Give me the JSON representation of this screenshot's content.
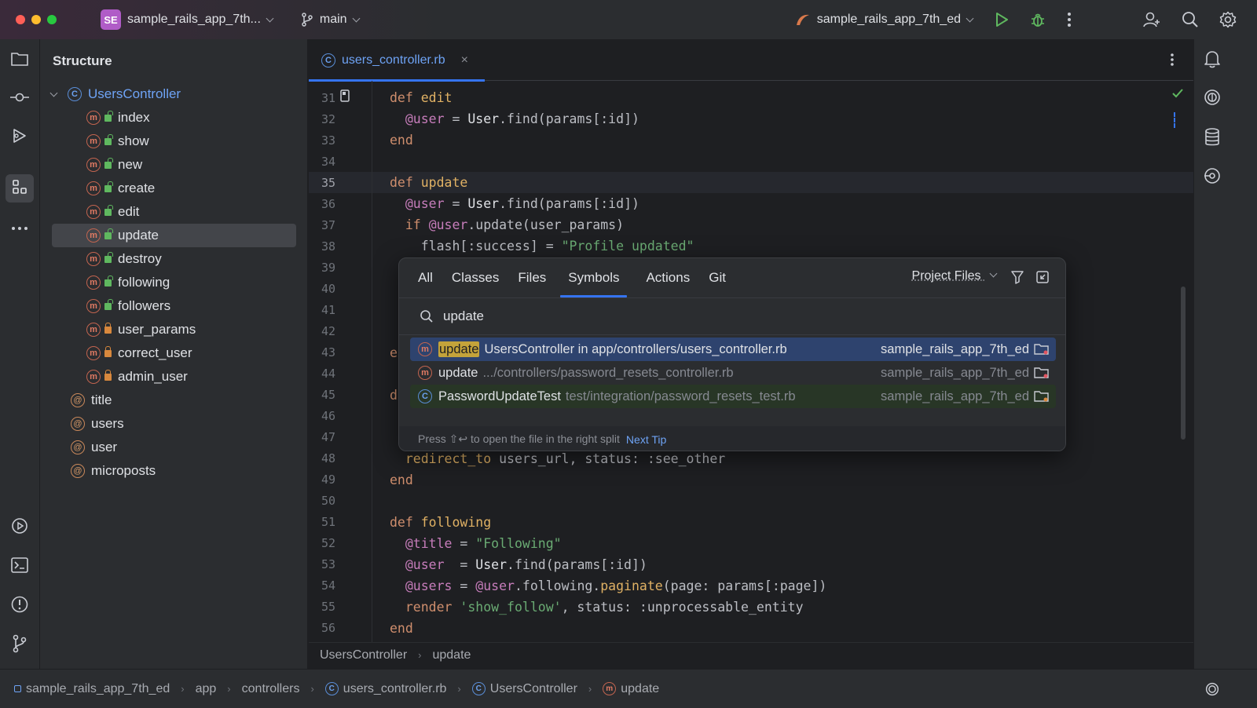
{
  "titlebar": {
    "project_badge": "SE",
    "project_name": "sample_rails_app_7th...",
    "branch": "main",
    "run_config": "sample_rails_app_7th_ed"
  },
  "structure": {
    "title": "Structure",
    "root": "UsersController",
    "items": [
      {
        "label": "index",
        "kind": "method",
        "access": "public"
      },
      {
        "label": "show",
        "kind": "method",
        "access": "public"
      },
      {
        "label": "new",
        "kind": "method",
        "access": "public"
      },
      {
        "label": "create",
        "kind": "method",
        "access": "public"
      },
      {
        "label": "edit",
        "kind": "method",
        "access": "public"
      },
      {
        "label": "update",
        "kind": "method",
        "access": "public",
        "selected": true
      },
      {
        "label": "destroy",
        "kind": "method",
        "access": "public"
      },
      {
        "label": "following",
        "kind": "method",
        "access": "public"
      },
      {
        "label": "followers",
        "kind": "method",
        "access": "public"
      },
      {
        "label": "user_params",
        "kind": "method",
        "access": "private"
      },
      {
        "label": "correct_user",
        "kind": "method",
        "access": "private"
      },
      {
        "label": "admin_user",
        "kind": "method",
        "access": "private"
      },
      {
        "label": "title",
        "kind": "ivar"
      },
      {
        "label": "users",
        "kind": "ivar"
      },
      {
        "label": "user",
        "kind": "ivar"
      },
      {
        "label": "microposts",
        "kind": "ivar"
      }
    ]
  },
  "editor": {
    "tab_label": "users_controller.rb",
    "tab_close": "×",
    "current_line": 35,
    "line_numbers": [
      "31",
      "32",
      "33",
      "34",
      "35",
      "36",
      "37",
      "38",
      "39",
      "40",
      "41",
      "42",
      "43",
      "44",
      "45",
      "46",
      "47",
      "48",
      "49",
      "50",
      "51",
      "52",
      "53",
      "54",
      "55",
      "56"
    ],
    "partial_lines": {
      "43": "e",
      "45": "d"
    }
  },
  "editor_breadcrumb": [
    "UsersController",
    "update"
  ],
  "popup": {
    "tabs": [
      "All",
      "Classes",
      "Files",
      "Symbols",
      "Actions",
      "Git"
    ],
    "active_tab": "Symbols",
    "scope": "Project Files",
    "query": "update",
    "results": [
      {
        "icon": "m",
        "name_highlight": "update",
        "name_rest": "",
        "location": "UsersController in app/controllers/users_controller.rb",
        "project": "sample_rails_app_7th_ed",
        "selected": true
      },
      {
        "icon": "m",
        "name_highlight": "",
        "name_rest": "update",
        "location": ".../controllers/password_resets_controller.rb",
        "project": "sample_rails_app_7th_ed"
      },
      {
        "icon": "c",
        "name_highlight": "",
        "name_rest": "PasswordUpdateTest",
        "location": "test/integration/password_resets_test.rb",
        "project": "sample_rails_app_7th_ed"
      }
    ],
    "footer_text": "Press ⇧↩ to open the file in the right split",
    "footer_link": "Next Tip"
  },
  "statusbar": {
    "crumbs": [
      "sample_rails_app_7th_ed",
      "app",
      "controllers",
      "users_controller.rb",
      "UsersController",
      "update"
    ]
  },
  "colors": {
    "accent": "#3574f0",
    "selection": "#2e436e",
    "highlight_match": "#c4a33a"
  }
}
